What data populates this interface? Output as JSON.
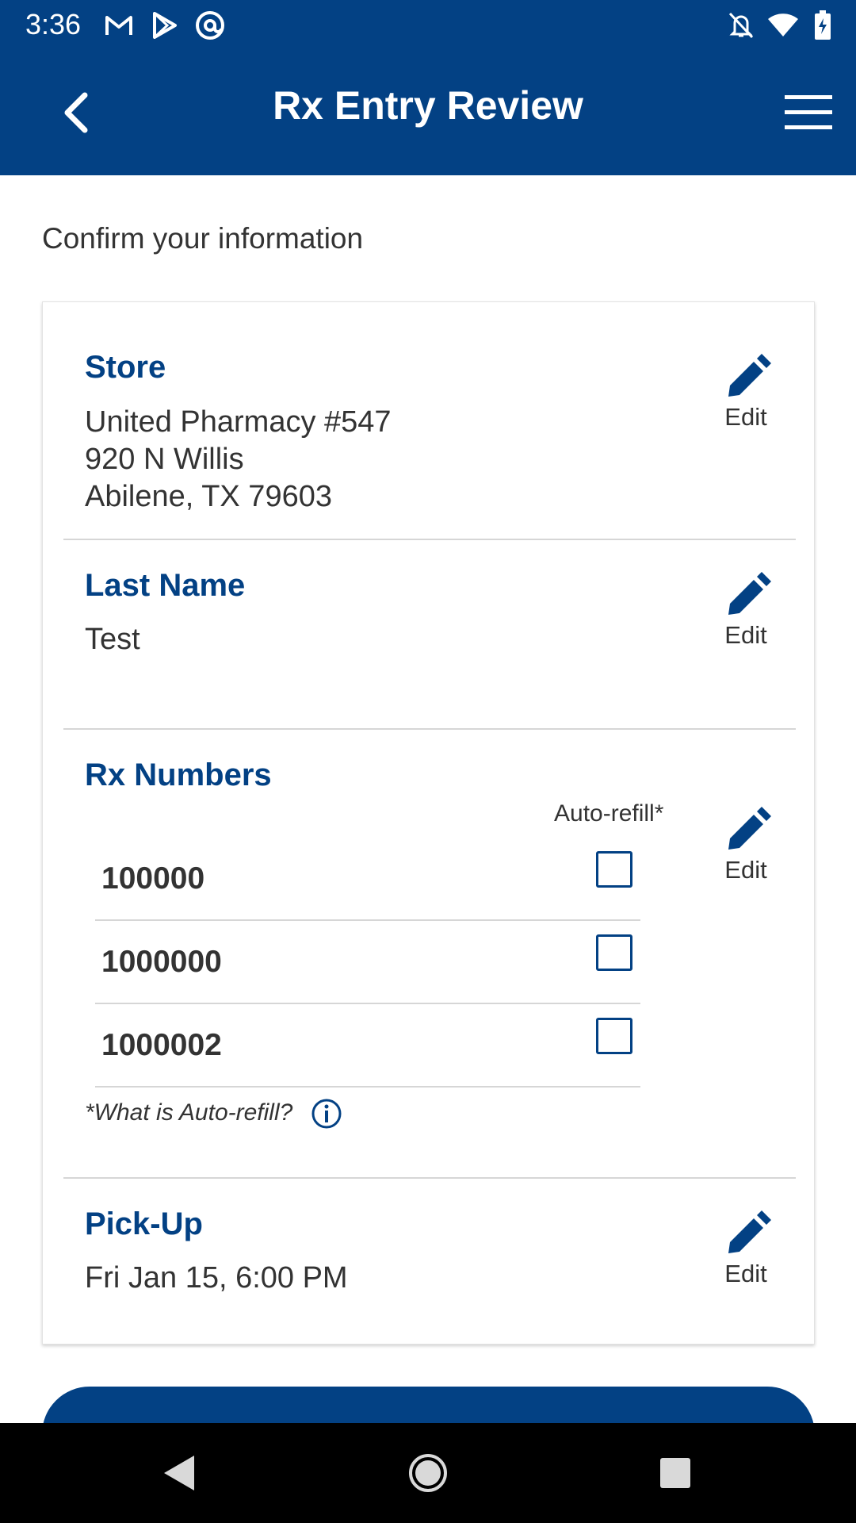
{
  "status_bar": {
    "time": "3:36",
    "left_icons": [
      "gmail-icon",
      "play-store-icon",
      "at-sign-icon"
    ],
    "right_icons": [
      "notifications-off-icon",
      "wifi-icon",
      "battery-charging-icon"
    ]
  },
  "app_bar": {
    "title": "Rx Entry Review",
    "back_icon": "chevron-left-icon",
    "menu_icon": "hamburger-menu-icon"
  },
  "subtitle": "Confirm your information",
  "store": {
    "title": "Store",
    "name": "United Pharmacy #547",
    "street": "920 N Willis",
    "city_state_zip": "Abilene, TX 79603",
    "edit_label": "Edit"
  },
  "last_name": {
    "title": "Last Name",
    "value": "Test",
    "edit_label": "Edit"
  },
  "rx_numbers": {
    "title": "Rx Numbers",
    "auto_refill_label": "Auto-refill*",
    "edit_label": "Edit",
    "items": [
      {
        "number": "100000",
        "auto_refill": false
      },
      {
        "number": "1000000",
        "auto_refill": false
      },
      {
        "number": "1000002",
        "auto_refill": false
      }
    ],
    "what_is_auto_refill": "*What is Auto-refill?"
  },
  "pickup": {
    "title": "Pick-Up",
    "value": "Fri Jan 15, 6:00 PM",
    "edit_label": "Edit"
  },
  "colors": {
    "brand": "#034184",
    "text": "#333333",
    "divider": "#d6d6d6"
  }
}
